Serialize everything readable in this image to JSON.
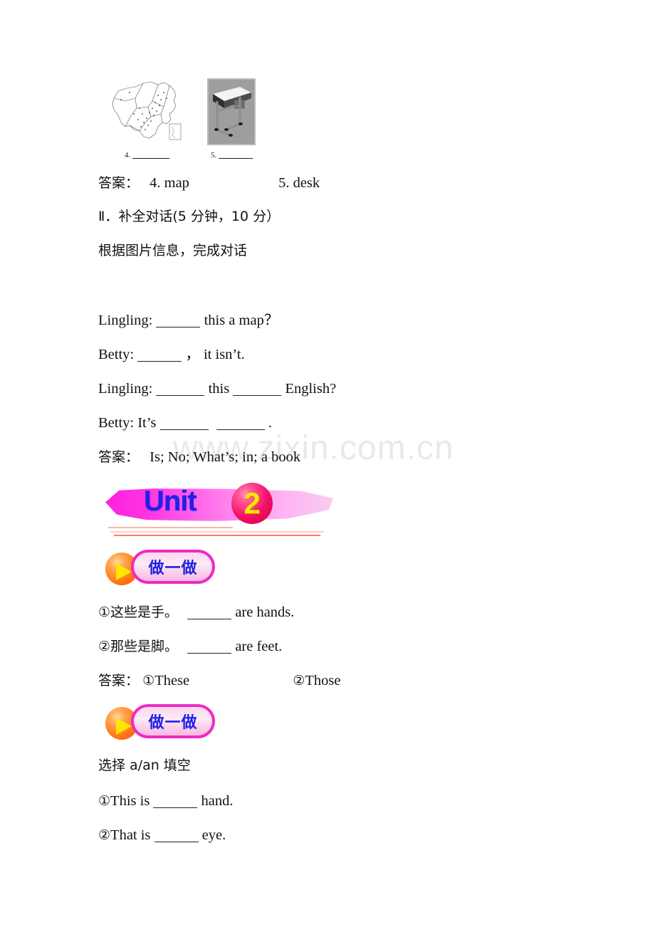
{
  "watermark": {
    "text": "www.zixin.com.cn"
  },
  "exercise_images": [
    {
      "name": "china-map-image",
      "number": "4.",
      "alt": "map of China"
    },
    {
      "name": "school-desk-image",
      "number": "5.",
      "alt": "school desk"
    }
  ],
  "section_one": {
    "answer_label": "答案：",
    "answers": [
      {
        "number": "4.",
        "value": "map"
      },
      {
        "number": "5.",
        "value": "desk"
      }
    ],
    "answer_line": "答案： 4. map                5. desk"
  },
  "section_two": {
    "heading": "Ⅱ．补全对话(5 分钟，10 分）",
    "instruction": "根据图片信息，完成对话",
    "dialogue": [
      {
        "speaker": "Lingling:",
        "before": "",
        "mid": "this a map？",
        "after": ""
      },
      {
        "speaker": "Betty:",
        "before": "",
        "mid": "，   it isn’t.",
        "after": ""
      },
      {
        "speaker": "Lingling:",
        "before": "",
        "mid": "this",
        "after": "English?"
      },
      {
        "speaker": "Betty: It’s",
        "before": "",
        "mid": "",
        "after": "."
      }
    ],
    "answer_label": "答案：",
    "answer_value": "Is; No; What’s; in; a book"
  },
  "unit_banner": {
    "word": "Unit",
    "number": "2",
    "blob_color": "#ff22e0",
    "word_color": "#1f22e8",
    "circle_color": "#f4106a",
    "number_color": "#ffe800"
  },
  "activity_one": {
    "button_label": "做一做",
    "items": [
      {
        "marker": "①",
        "cn": "这些是手。",
        "en_after": "are hands."
      },
      {
        "marker": "②",
        "cn": "那些是脚。",
        "en_after": "are feet."
      }
    ],
    "answer_label": "答案：",
    "answers": [
      {
        "marker": "①",
        "value": "These"
      },
      {
        "marker": "②",
        "value": "Those"
      }
    ]
  },
  "activity_two": {
    "button_label": "做一做",
    "instruction": "选择 a/an 填空",
    "items": [
      {
        "marker": "①",
        "before": "This is",
        "after": "hand."
      },
      {
        "marker": "②",
        "before": "That is",
        "after": "eye."
      }
    ]
  }
}
